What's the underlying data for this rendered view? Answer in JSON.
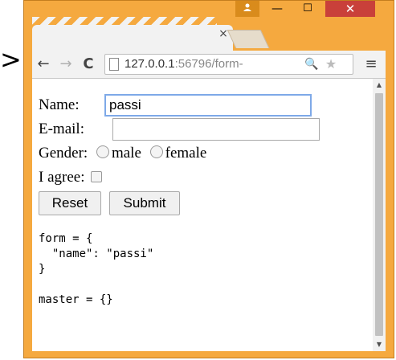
{
  "caret": ">",
  "window": {
    "tab_close": "×",
    "profile_icon": "person-icon",
    "minimize": "—",
    "maximize": "☐",
    "close": "✕"
  },
  "toolbar": {
    "back": "←",
    "forward": "→",
    "reload": "C",
    "url_host": "127.0.0.1",
    "url_rest": ":56796/form-",
    "zoom": "🔍",
    "star": "★",
    "menu": "≡"
  },
  "form": {
    "name_label": "Name:",
    "name_value": "passi",
    "email_label": "E-mail:",
    "email_value": "",
    "gender_label": "Gender:",
    "gender_options": [
      "male",
      "female"
    ],
    "agree_label": "I agree:",
    "reset_label": "Reset",
    "submit_label": "Submit"
  },
  "debug": {
    "form_line1": "form = {",
    "form_line2": "  \"name\": \"passi\"",
    "form_line3": "}",
    "master_line": "master = {}"
  },
  "colors": {
    "frame": "#f5a93f",
    "close_button": "#c9403a",
    "focus_ring": "#7ea9e8"
  }
}
